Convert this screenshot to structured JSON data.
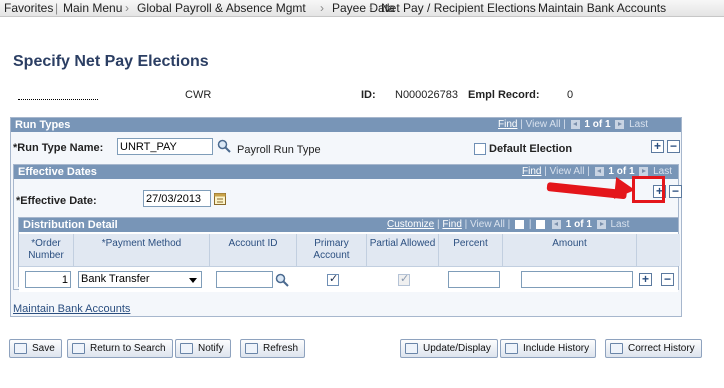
{
  "nav": {
    "items": [
      "Favorites",
      "Main Menu",
      "Global Payroll & Absence Mgmt",
      "Payee Data",
      "Net Pay / Recipient Elections",
      "Maintain Bank Accounts"
    ],
    "separators": [
      "›",
      "›",
      "›",
      "›"
    ]
  },
  "page": {
    "title": "Specify Net Pay Elections"
  },
  "header": {
    "name": "CWR",
    "id_label": "ID:",
    "id_value": "N000026783",
    "empl_record_label": "Empl Record:",
    "empl_record_value": "0"
  },
  "run_types": {
    "title": "Run Types",
    "nav_find": "Find",
    "nav_view_all": "View All",
    "nav_count": "1 of 1",
    "nav_first": "First",
    "nav_last": "Last",
    "run_type_label": "*Run Type Name:",
    "run_type_value": "UNRT_PAY",
    "run_type_desc": "Payroll Run Type",
    "default_election_label": "Default Election",
    "default_election_checked": false
  },
  "effective_dates": {
    "title": "Effective Dates",
    "nav_find": "Find",
    "nav_view_all": "View All",
    "nav_count": "1 of 1",
    "nav_first": "First",
    "nav_last": "Last",
    "effective_date_label": "*Effective Date:",
    "effective_date_value": "27/03/2013"
  },
  "distribution": {
    "title": "Distribution Detail",
    "nav_customize": "Customize",
    "nav_find": "Find",
    "nav_view_all": "View All",
    "nav_count": "1 of 1",
    "nav_first": "First",
    "nav_last": "Last",
    "columns": {
      "order_number": "*Order Number",
      "payment_method": "*Payment Method",
      "account_id": "Account ID",
      "primary_account": "Primary Account",
      "partial_allowed": "Partial Allowed",
      "percent": "Percent",
      "amount": "Amount"
    },
    "rows": [
      {
        "order_number": "1",
        "payment_method": "Bank Transfer",
        "account_id": "",
        "primary_account": true,
        "partial_allowed": true,
        "percent": "",
        "amount": ""
      }
    ]
  },
  "links": {
    "maintain_bank_accounts": "Maintain Bank Accounts"
  },
  "buttons": {
    "save": "Save",
    "return_to_search": "Return to Search",
    "notify": "Notify",
    "refresh": "Refresh",
    "update_display": "Update/Display",
    "include_history": "Include History",
    "correct_history": "Correct History"
  },
  "colors": {
    "title": "#2b3e63",
    "section_header": "#7895b7",
    "annotation": "#e4161b"
  },
  "icons": {
    "lookup": "magnifier",
    "calendar": "calendar",
    "add": "plus",
    "delete": "minus"
  }
}
